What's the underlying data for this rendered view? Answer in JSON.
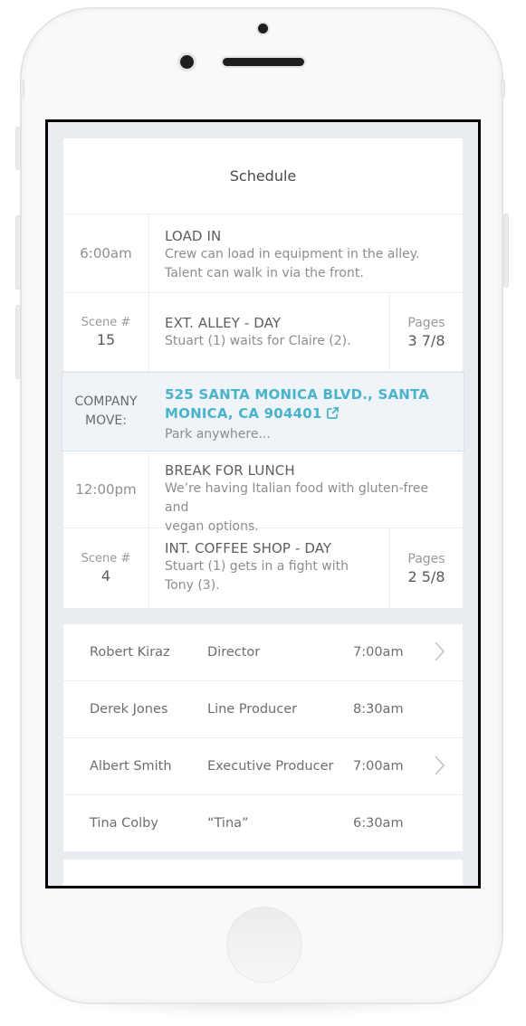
{
  "header": {
    "title": "Schedule"
  },
  "schedule": {
    "load_in": {
      "time": "6:00am",
      "title": "LOAD IN",
      "desc_line1": "Crew can load in equipment in the alley.",
      "desc_line2": "Talent can walk in via the front."
    },
    "scene1": {
      "scene_label": "Scene #",
      "scene_number": "15",
      "title": "EXT. ALLEY - DAY",
      "desc": "Stuart (1) waits for Claire (2).",
      "pages_label": "Pages",
      "pages_value": "3 7/8"
    },
    "company_move": {
      "label_line1": "COMPANY",
      "label_line2": "MOVE:",
      "address_line1": "525 SANTA MONICA BLVD., SANTA",
      "address_line2": "MONICA, CA 904401",
      "note": "Park anywhere...",
      "link_color": "#4ab3cc",
      "icon": "external-link-icon"
    },
    "lunch": {
      "time": "12:00pm",
      "title": "BREAK FOR LUNCH",
      "desc_line1": "We’re having Italian food with gluten-free and",
      "desc_line2": "vegan options."
    },
    "scene2": {
      "scene_label": "Scene #",
      "scene_number": "4",
      "title": "INT. COFFEE SHOP - DAY",
      "desc_line1": "Stuart (1) gets in a fight with",
      "desc_line2": "Tony (3).",
      "pages_label": "Pages",
      "pages_value": "2 5/8"
    }
  },
  "crew": [
    {
      "name": "Robert Kiraz",
      "role": "Director",
      "time": "7:00am",
      "has_chevron": true
    },
    {
      "name": "Derek Jones",
      "role": "Line Producer",
      "time": "8:30am",
      "has_chevron": false
    },
    {
      "name": "Albert Smith",
      "role": "Executive Producer",
      "time": "7:00am",
      "has_chevron": true
    },
    {
      "name": "Tina Colby",
      "role": "“Tina”",
      "time": "6:30am",
      "has_chevron": false
    }
  ],
  "colors": {
    "accent": "#4ab3cc",
    "screen_bg": "#e9edf1",
    "highlight_row_bg": "#eef4f8"
  }
}
